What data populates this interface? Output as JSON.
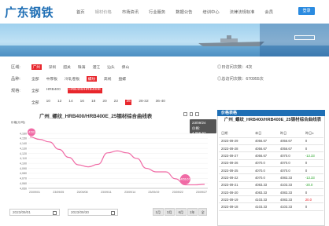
{
  "header": {
    "logo": "广东钢铁",
    "nav": [
      "首页",
      "钢材价格",
      "市场资讯",
      "行业服务",
      "数据公告",
      "培训中心",
      "法律法规标准",
      "会员"
    ],
    "active_nav": 1,
    "login_label": "登录"
  },
  "banner": {
    "text": "",
    "button": "",
    "sub": ""
  },
  "filters": {
    "region": {
      "label": "区域:",
      "options": [
        "广州",
        "深圳",
        "韶关",
        "珠海",
        "湛江",
        "汕头",
        "佛山"
      ],
      "selected": 0
    },
    "brand": {
      "label": "品种:",
      "options": [
        "全部",
        "中厚板",
        "冷轧卷板",
        "螺纹",
        "高线",
        "盘螺"
      ],
      "selected": 3
    },
    "spec": {
      "label": "规格:",
      "options": [
        "全部",
        "HRB400",
        "HRB400/HRB400E"
      ],
      "selected": 2
    },
    "size": {
      "options": [
        "全部",
        "10",
        "12",
        "14",
        "16",
        "18",
        "20",
        "22",
        "25",
        "28-32",
        "36-40"
      ],
      "selected": 8
    }
  },
  "stats": {
    "today_count": "◎日访问次数：4次",
    "total_count": "◎总访问次数：670955次"
  },
  "chart": {
    "title": "广州_螺纹_HRB400/HRB400E_25钢材综合曲线表",
    "ylabel": "价格(元/吨)",
    "tooltip_date": "23/09/24",
    "tooltip_value": "价格: 4,056.67",
    "range_buttons": [
      "1月",
      "3月",
      "6月",
      "1年",
      "全"
    ],
    "date_from": "2023/09/01",
    "date_to": "2023/09/30"
  },
  "chart_data": {
    "type": "line",
    "title": "广州_螺纹_HRB400/HRB400E_25钢材综合曲线表",
    "ylabel": "价格(元/吨)",
    "ylim": [
      4050,
      4160
    ],
    "yticks": [
      "4,050",
      "4,060",
      "4,070",
      "4,080",
      "4,090",
      "4,100",
      "4,110",
      "4,120",
      "4,130",
      "4,140",
      "4,150",
      "4,160"
    ],
    "xticks": [
      "23/09/01",
      "23/09/05",
      "23/09/08",
      "23/09/11",
      "23/09/14",
      "23/09/19",
      "23/09/22",
      "23/09/27"
    ],
    "series": [
      {
        "x": [
          "23/09/01",
          "23/09/04",
          "23/09/05",
          "23/09/06",
          "23/09/07",
          "23/09/08",
          "23/09/11",
          "23/09/12",
          "23/09/13",
          "23/09/14",
          "23/09/15",
          "23/09/18",
          "23/09/19",
          "23/09/20",
          "23/09/21",
          "23/09/22",
          "23/09/25",
          "23/09/26",
          "23/09/27"
        ],
        "values": [
          4153,
          4148,
          4143,
          4128,
          4112,
          4097,
          4093,
          4098,
          4121,
          4125,
          4121,
          4110,
          4090,
          4083,
          4083,
          4069,
          4057,
          4057,
          4058
        ]
      }
    ],
    "labels": {
      "first": "4150",
      "last": "4056.67"
    }
  },
  "price_panel": {
    "header": "价格表格",
    "title": "广州_螺纹_HRB400/HRB400E_25钢材综合曲线表",
    "columns": [
      "日期",
      "本日",
      "昨日",
      "昨日±"
    ],
    "rows": [
      [
        "2023-09-29",
        "4056.67",
        "4056.67",
        "0"
      ],
      [
        "2023-09-28",
        "4056.67",
        "4056.67",
        "0"
      ],
      [
        "2023-09-27",
        "4056.67",
        "4070.0",
        "-13.33"
      ],
      [
        "2023-09-26",
        "4070.0",
        "4070.0",
        "0"
      ],
      [
        "2023-09-25",
        "4070.0",
        "4070.0",
        "0"
      ],
      [
        "2023-09-22",
        "4070.0",
        "4083.33",
        "-13.33"
      ],
      [
        "2023-09-21",
        "4083.33",
        "4103.33",
        "-20.0"
      ],
      [
        "2023-09-20",
        "4083.33",
        "4083.33",
        "0"
      ],
      [
        "2023-09-19",
        "4103.33",
        "4083.33",
        "20.0"
      ],
      [
        "2023-09-18",
        "4103.33",
        "4103.33",
        "0"
      ]
    ]
  },
  "colors": {
    "brand": "#1f6fb5",
    "accent": "#e8262c",
    "line": "#f06aa5",
    "up": "#e8262c",
    "down": "#2aa52a"
  }
}
